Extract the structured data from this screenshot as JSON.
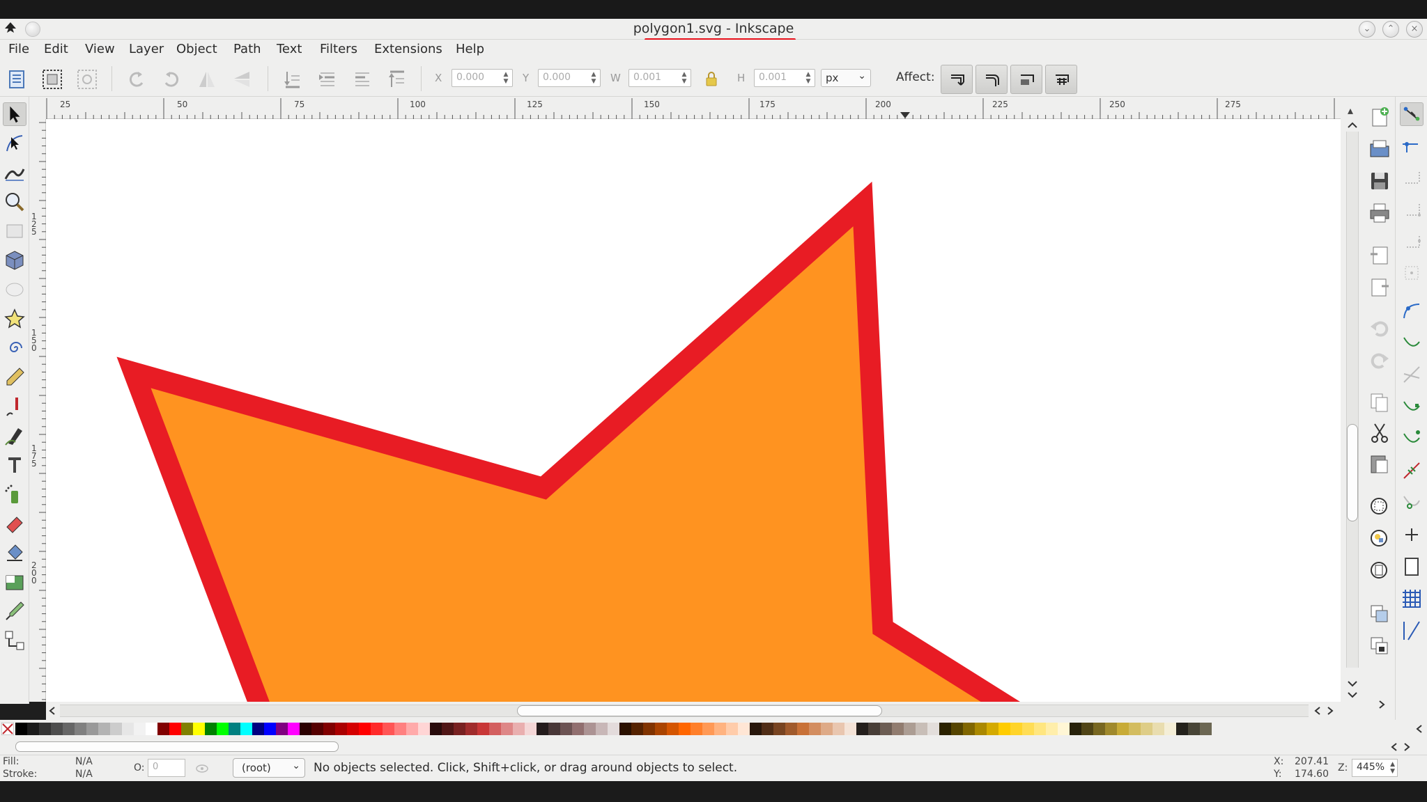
{
  "window": {
    "title": "polygon1.svg - Inkscape",
    "title_underline_color": "#e8101a"
  },
  "menubar": {
    "items": [
      {
        "label": "File"
      },
      {
        "label": "Edit"
      },
      {
        "label": "View"
      },
      {
        "label": "Layer"
      },
      {
        "label": "Object"
      },
      {
        "label": "Path"
      },
      {
        "label": "Text"
      },
      {
        "label": "Filters"
      },
      {
        "label": "Extensions"
      },
      {
        "label": "Help"
      }
    ]
  },
  "controls": {
    "x_label": "X",
    "x_value": "0.000",
    "y_label": "Y",
    "y_value": "0.000",
    "w_label": "W",
    "w_value": "0.001",
    "h_label": "H",
    "h_value": "0.001",
    "unit": "px",
    "affect_label": "Affect:"
  },
  "ruler_top": {
    "labels": [
      "25",
      "50",
      "75",
      "100",
      "125",
      "150",
      "175",
      "200",
      "225",
      "250",
      "275"
    ]
  },
  "ruler_left": {
    "labels": [
      "125",
      "150",
      "175",
      "200"
    ]
  },
  "canvas": {
    "shape": "polygon",
    "fill_color": "#ff9320",
    "stroke_color": "#e81c24"
  },
  "palette": {
    "none_icon": "x-icon",
    "colors": [
      "#000000",
      "#1a1a1a",
      "#333333",
      "#4d4d4d",
      "#666666",
      "#808080",
      "#999999",
      "#b3b3b3",
      "#cccccc",
      "#e6e6e6",
      "#f2f2f2",
      "#ffffff",
      "#800000",
      "#ff0000",
      "#808000",
      "#ffff00",
      "#008000",
      "#00ff00",
      "#008080",
      "#00ffff",
      "#000080",
      "#0000ff",
      "#800080",
      "#ff00ff",
      "#2b0000",
      "#550000",
      "#800000",
      "#aa0000",
      "#d40000",
      "#ff0000",
      "#ff2a2a",
      "#ff5555",
      "#ff8080",
      "#ffaaaa",
      "#ffd5d5",
      "#280b0b",
      "#501616",
      "#782121",
      "#a02c2c",
      "#c83737",
      "#d35f5f",
      "#de8787",
      "#e9afaf",
      "#f4d7d7",
      "#241c1c",
      "#483737",
      "#6c5353",
      "#916f6f",
      "#ac9393",
      "#c8b7b7",
      "#e3dbdb",
      "#2b1100",
      "#552200",
      "#803300",
      "#aa4400",
      "#d45500",
      "#ff6600",
      "#ff7f2a",
      "#ff9955",
      "#ffb380",
      "#ffccaa",
      "#ffe6d5",
      "#28170b",
      "#502d16",
      "#784421",
      "#a05a2c",
      "#c87137",
      "#d38d5f",
      "#deaa87",
      "#e9c6af",
      "#f4e3d7",
      "#241f1c",
      "#483e37",
      "#6c5d53",
      "#917c6f",
      "#ac9d93",
      "#c8beb7",
      "#e3dedb",
      "#2b2200",
      "#554400",
      "#806600",
      "#aa8800",
      "#d4aa00",
      "#ffcc00",
      "#ffd42a",
      "#ffdd55",
      "#ffe680",
      "#ffeeaa",
      "#fff6d5",
      "#28220b",
      "#504416",
      "#786721",
      "#a0892c",
      "#c8ab37",
      "#d3bc5f",
      "#decd87",
      "#e9ddaf",
      "#f4eed7",
      "#24221c",
      "#484537",
      "#6c6753"
    ]
  },
  "statusbar": {
    "fill_label": "Fill:",
    "fill_value": "N/A",
    "stroke_label": "Stroke:",
    "stroke_value": "N/A",
    "opacity_label": "O:",
    "opacity_value": "0",
    "layer": "(root)",
    "message": "No objects selected. Click, Shift+click, or drag around objects to select.",
    "x_label": "X:",
    "x_value": "207.41",
    "y_label": "Y:",
    "y_value": "174.60",
    "zoom_label": "Z:",
    "zoom_value": "445%"
  }
}
